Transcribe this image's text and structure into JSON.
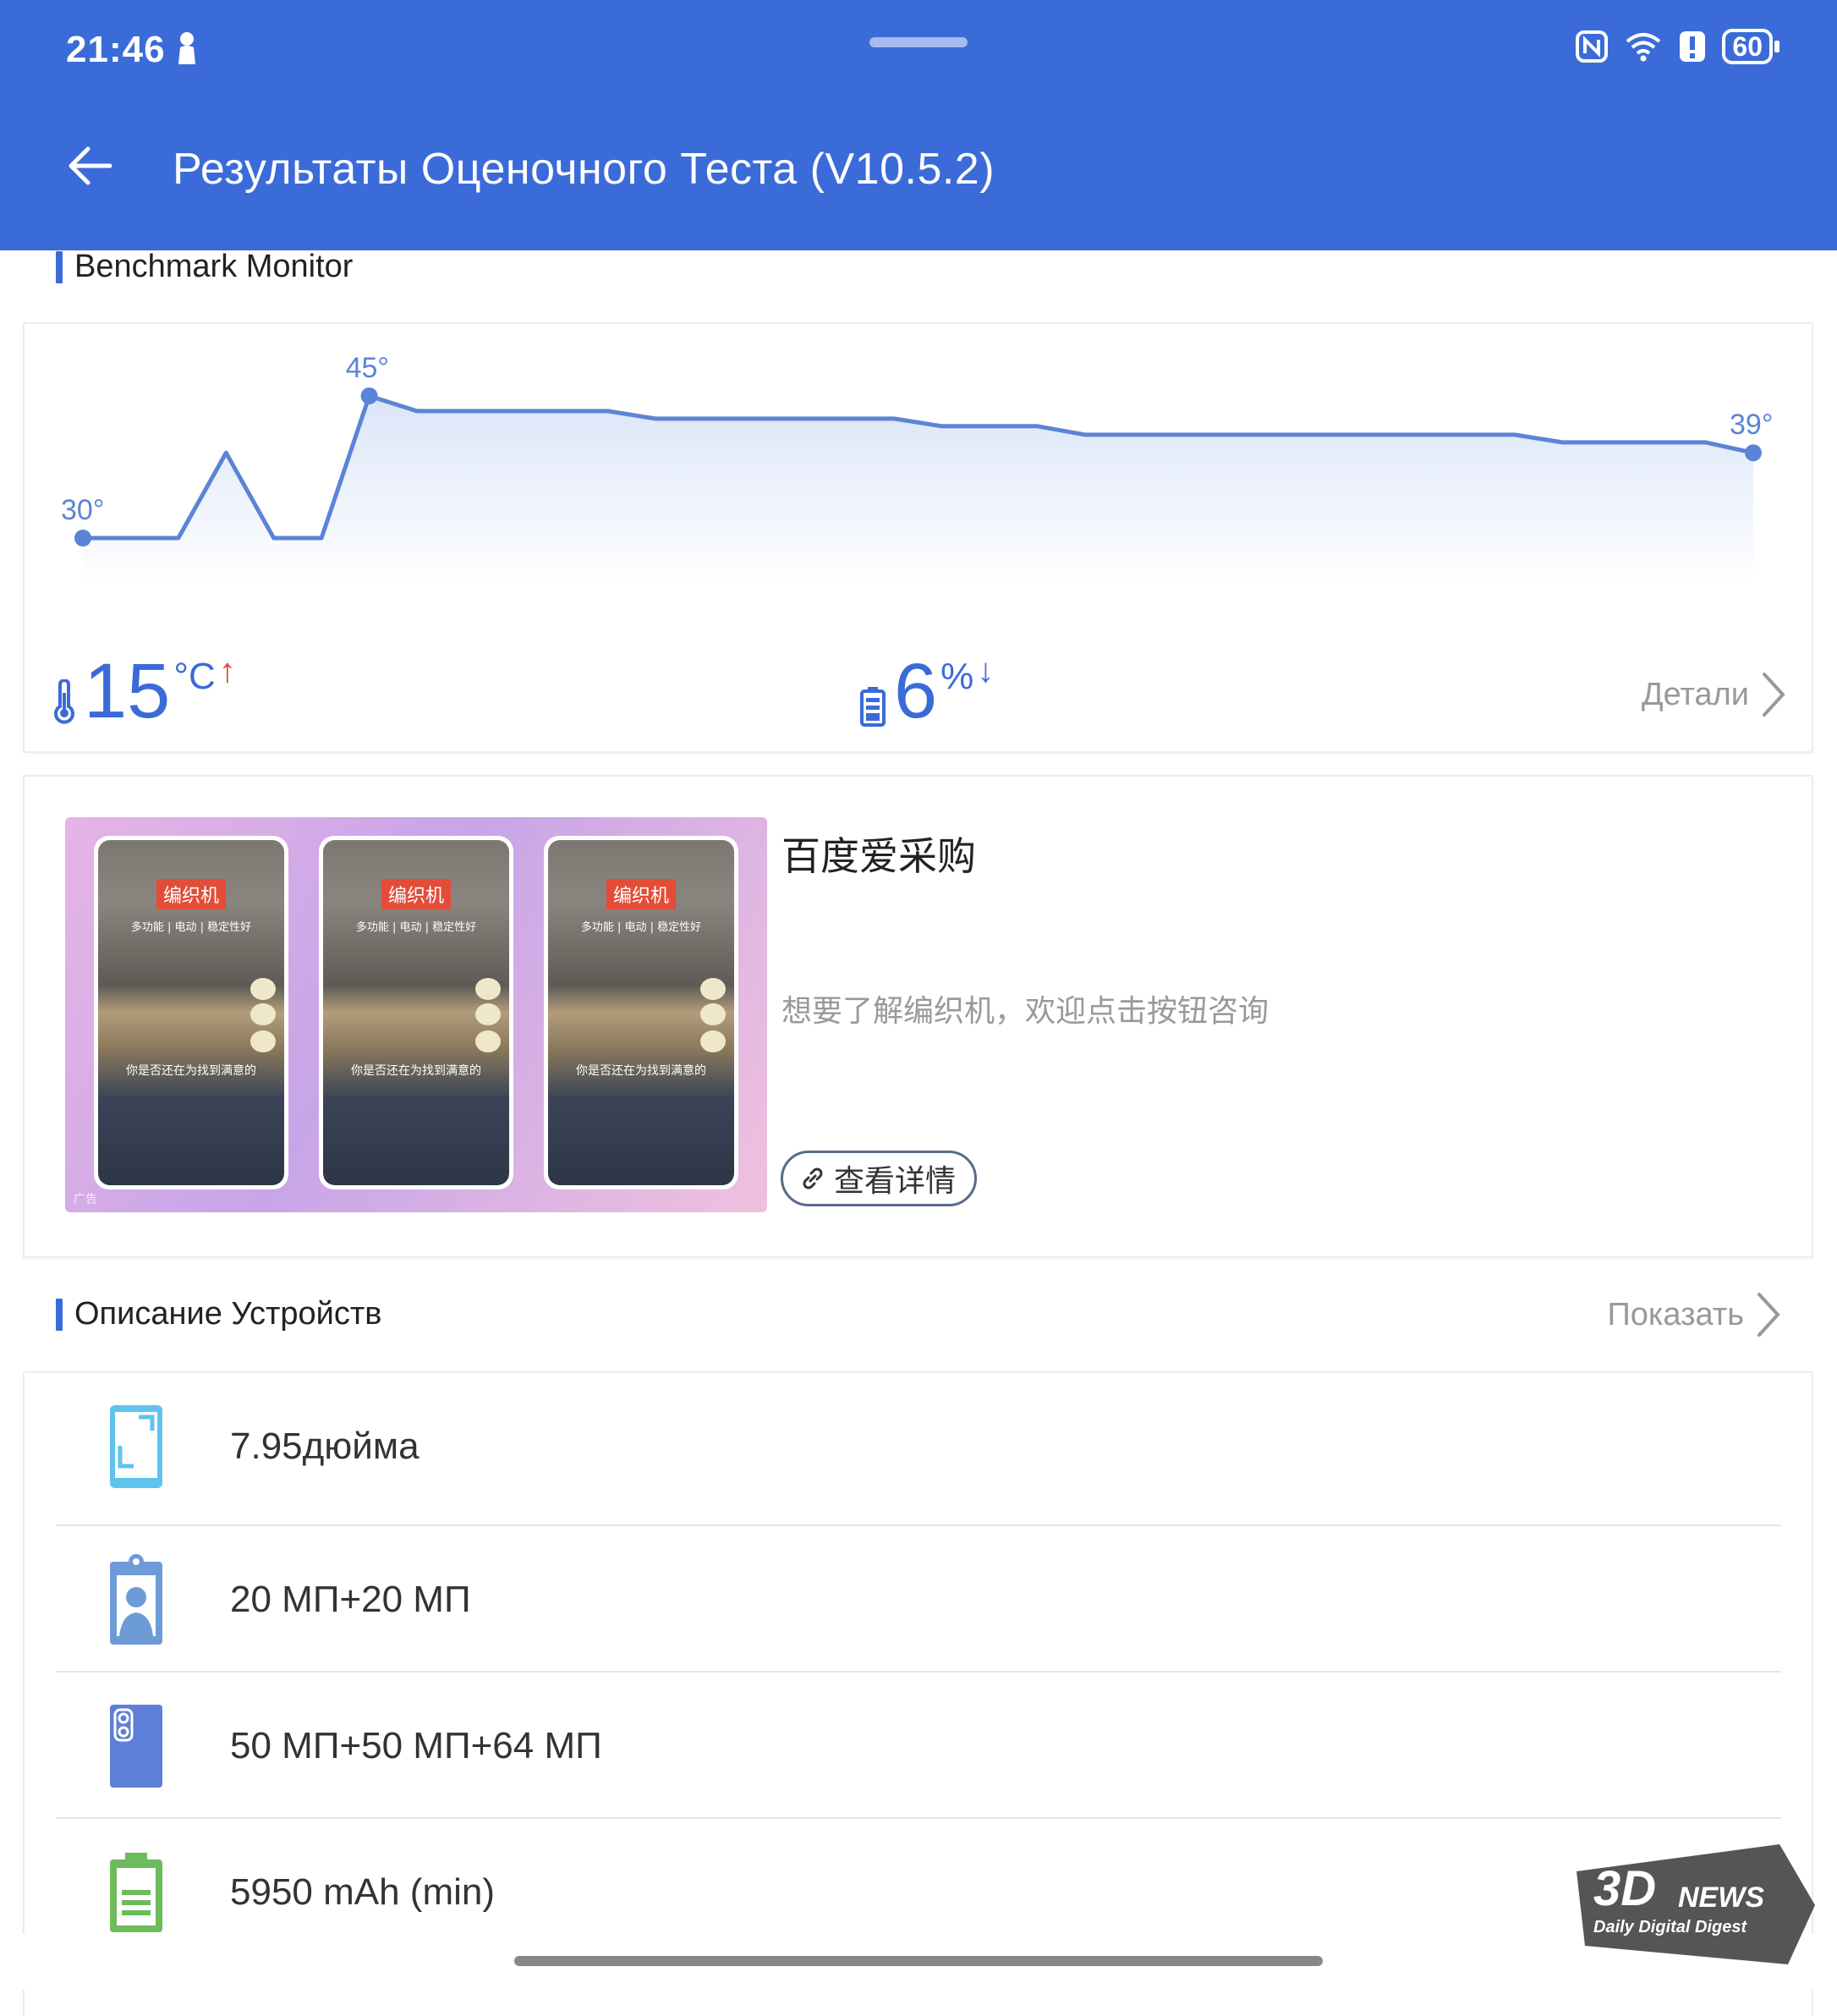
{
  "status_bar": {
    "time": "21:46",
    "battery": "60"
  },
  "header": {
    "title": "Результаты Оценочного Теста (V10.5.2)"
  },
  "benchmark_monitor": {
    "section_title": "Benchmark Monitor",
    "chart_data": {
      "type": "area",
      "annotations": [
        "30°",
        "45°",
        "39°"
      ],
      "values": [
        30,
        30,
        30,
        39,
        30,
        30,
        45,
        43.4,
        43.4,
        43.4,
        43.4,
        43.4,
        42.6,
        42.6,
        42.6,
        42.6,
        42.6,
        42.6,
        41.8,
        41.8,
        41.8,
        40.9,
        40.9,
        40.9,
        40.9,
        40.9,
        40.9,
        40.9,
        40.9,
        40.9,
        40.9,
        40.1,
        40.1,
        40.1,
        40.1,
        39
      ],
      "start": 30,
      "peak": 45,
      "end": 39,
      "color": "#5b84d6"
    },
    "temp_change": {
      "value": "15",
      "unit": "°C",
      "direction": "↑"
    },
    "battery_change": {
      "value": "6",
      "unit": "%",
      "direction": "↓"
    },
    "details_label": "Детали"
  },
  "ad": {
    "title": "百度爱采购",
    "description": "想要了解编织机，欢迎点击按钮咨询",
    "button_label": "查看详情",
    "image": {
      "tag": "编织机",
      "subtitle": "多功能 | 电动 | 稳定性好",
      "caption": "你是否还在为找到满意的",
      "badge": "广告"
    }
  },
  "device_info": {
    "section_title": "Описание Устройств",
    "show_label": "Показать",
    "items": [
      {
        "icon": "screen-icon",
        "text": "7.95дюйма"
      },
      {
        "icon": "front-camera-icon",
        "text": "20 МП+20 МП"
      },
      {
        "icon": "rear-camera-icon",
        "text": "50 МП+50 МП+64 МП"
      },
      {
        "icon": "battery-icon",
        "text": "5950 mAh (min)"
      }
    ]
  },
  "colors": {
    "primary": "#3b6bd8",
    "accent_up": "#d84b3b",
    "muted": "#999999"
  }
}
